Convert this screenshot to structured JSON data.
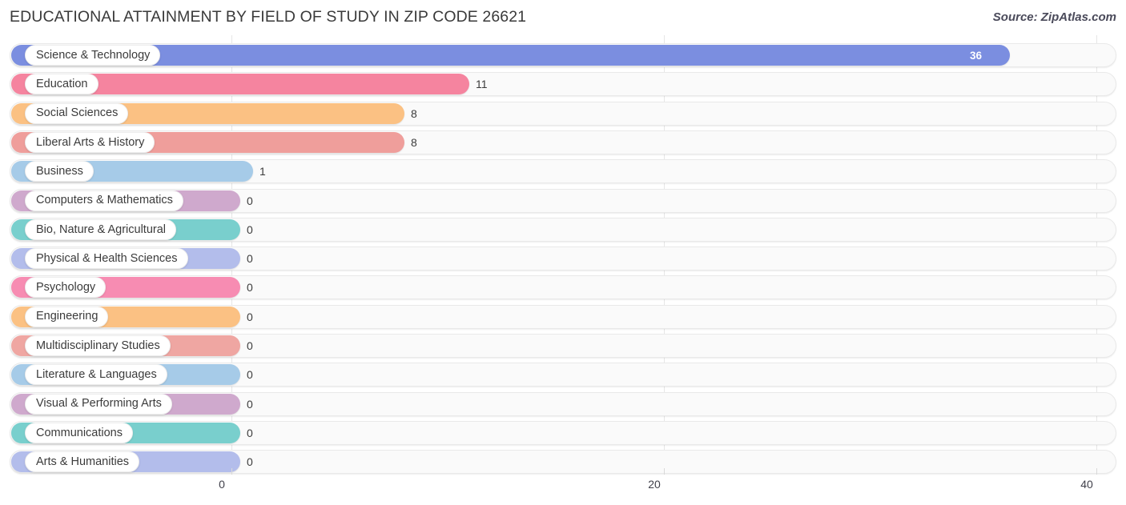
{
  "header": {
    "title": "EDUCATIONAL ATTAINMENT BY FIELD OF STUDY IN ZIP CODE 26621",
    "source": "Source: ZipAtlas.com"
  },
  "chart_data": {
    "type": "bar",
    "orientation": "horizontal",
    "title": "EDUCATIONAL ATTAINMENT BY FIELD OF STUDY IN ZIP CODE 26621",
    "subtitle": "Source: ZipAtlas.com",
    "xlabel": "",
    "ylabel": "",
    "xlim": [
      0,
      40
    ],
    "xticks": [
      0,
      20,
      40
    ],
    "xtick_labels": [
      "0",
      "20",
      "40"
    ],
    "grid": true,
    "legend": false,
    "categories": [
      "Science & Technology",
      "Education",
      "Social Sciences",
      "Liberal Arts & History",
      "Business",
      "Computers & Mathematics",
      "Bio, Nature & Agricultural",
      "Physical & Health Sciences",
      "Psychology",
      "Engineering",
      "Multidisciplinary Studies",
      "Literature & Languages",
      "Visual & Performing Arts",
      "Communications",
      "Arts & Humanities"
    ],
    "values": [
      36,
      11,
      8,
      8,
      1,
      0,
      0,
      0,
      0,
      0,
      0,
      0,
      0,
      0,
      0
    ],
    "value_labels": [
      "36",
      "11",
      "8",
      "8",
      "1",
      "0",
      "0",
      "0",
      "0",
      "0",
      "0",
      "0",
      "0",
      "0",
      "0"
    ],
    "colors": [
      "#7b8ee0",
      "#f5849f",
      "#fbc183",
      "#ef9e9b",
      "#a6cbe8",
      "#cfa9cd",
      "#79cfcd",
      "#b3bdeb",
      "#f78cb2",
      "#fbc183",
      "#efa6a2",
      "#a6cbe8",
      "#cfa9cd",
      "#79cfcd",
      "#b3bdeb"
    ]
  },
  "bars": [
    {
      "label": "Science & Technology",
      "value": "36",
      "color": "#7b8ee0",
      "value_inside": true
    },
    {
      "label": "Education",
      "value": "11",
      "color": "#f5849f",
      "value_inside": false
    },
    {
      "label": "Social Sciences",
      "value": "8",
      "color": "#fbc183",
      "value_inside": false
    },
    {
      "label": "Liberal Arts & History",
      "value": "8",
      "color": "#ef9e9b",
      "value_inside": false
    },
    {
      "label": "Business",
      "value": "1",
      "color": "#a6cbe8",
      "value_inside": false
    },
    {
      "label": "Computers & Mathematics",
      "value": "0",
      "color": "#cfa9cd",
      "value_inside": false
    },
    {
      "label": "Bio, Nature & Agricultural",
      "value": "0",
      "color": "#79cfcd",
      "value_inside": false
    },
    {
      "label": "Physical & Health Sciences",
      "value": "0",
      "color": "#b3bdeb",
      "value_inside": false
    },
    {
      "label": "Psychology",
      "value": "0",
      "color": "#f78cb2",
      "value_inside": false
    },
    {
      "label": "Engineering",
      "value": "0",
      "color": "#fbc183",
      "value_inside": false
    },
    {
      "label": "Multidisciplinary Studies",
      "value": "0",
      "color": "#efa6a2",
      "value_inside": false
    },
    {
      "label": "Literature & Languages",
      "value": "0",
      "color": "#a6cbe8",
      "value_inside": false
    },
    {
      "label": "Visual & Performing Arts",
      "value": "0",
      "color": "#cfa9cd",
      "value_inside": false
    },
    {
      "label": "Communications",
      "value": "0",
      "color": "#79cfcd",
      "value_inside": false
    },
    {
      "label": "Arts & Humanities",
      "value": "0",
      "color": "#b3bdeb",
      "value_inside": false
    }
  ],
  "axis": {
    "ticks": [
      "0",
      "20",
      "40"
    ]
  }
}
